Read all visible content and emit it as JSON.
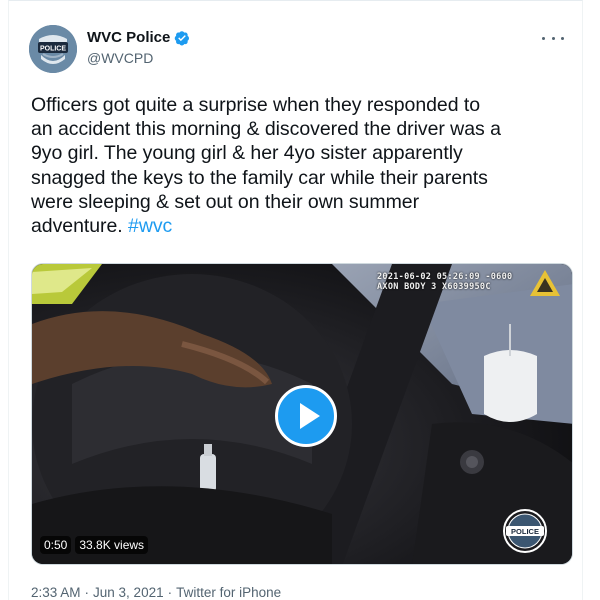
{
  "author": {
    "display_name": "WVC Police",
    "handle": "@WVCPD",
    "verified": true,
    "avatar_icon": "police-badge-avatar",
    "avatar_text": "POLICE"
  },
  "tweet": {
    "text_lines": [
      "Officers got quite a surprise when they responded to",
      "an accident this morning & discovered the driver was a",
      "9yo girl.  The young girl & her 4yo sister apparently",
      "snagged the keys to the family car while their parents",
      "were sleeping & set out on their own summer",
      "adventure."
    ],
    "hashtag": "#wvc"
  },
  "media": {
    "bodycam_line1": "2021-06-02 05:26:09 -0600",
    "bodycam_line2": "AXON BODY 3 X6039950C",
    "duration": "0:50",
    "views": "33.8K views",
    "badge_text": "POLICE",
    "play_icon": "play-icon"
  },
  "meta": {
    "time": "2:33 AM",
    "separator": "·",
    "date": "Jun 3, 2021",
    "source": "Twitter for iPhone"
  },
  "colors": {
    "link": "#1d9bf0",
    "text": "#0f1419",
    "secondary": "#536471"
  }
}
